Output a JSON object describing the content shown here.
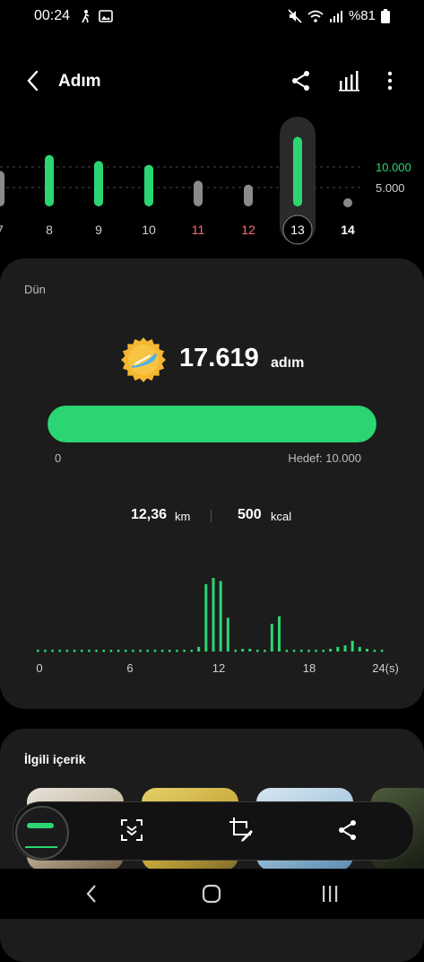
{
  "status": {
    "time": "00:24",
    "battery": "%81",
    "icons": [
      "person-walk-icon",
      "image-icon",
      "mute-icon",
      "wifi-icon",
      "signal-icon",
      "battery-icon"
    ]
  },
  "header": {
    "title": "Adım",
    "actions": [
      "share-icon",
      "stats-icon",
      "more-vert-icon"
    ]
  },
  "week_chart": {
    "days": [
      "7",
      "8",
      "9",
      "10",
      "11",
      "12",
      "13",
      "14"
    ],
    "goal_label": "10.000",
    "half_label": "5.000",
    "selected": "13",
    "day_colors": {
      "7": "#cfcfcf",
      "8": "#cfcfcf",
      "9": "#cfcfcf",
      "10": "#cfcfcf",
      "11": "#ff6b6b",
      "12": "#ff6b6b",
      "13": "#ffffff",
      "14": "#ffffff"
    },
    "steps": [
      9000,
      13000,
      11500,
      10500,
      6500,
      5500,
      17619,
      1200
    ],
    "met_goal": [
      false,
      true,
      true,
      true,
      false,
      false,
      true,
      false
    ]
  },
  "summary": {
    "day_label": "Dün",
    "steps": "17.619",
    "steps_unit": "adım",
    "progress_min": "0",
    "goal_text": "Hedef: 10.000",
    "progress_fraction": 1.0,
    "distance_value": "12,36",
    "distance_unit": "km",
    "calories_value": "500",
    "calories_unit": "kcal",
    "accent_color": "#2bd672"
  },
  "chart_data": {
    "type": "bar",
    "x_ticks": [
      "0",
      "6",
      "12",
      "18",
      "24(s)"
    ],
    "x": [
      0.0,
      0.5,
      1.0,
      1.5,
      2.0,
      2.5,
      3.0,
      3.5,
      4.0,
      4.5,
      5.0,
      5.5,
      6.0,
      6.5,
      7.0,
      7.5,
      8.0,
      8.5,
      9.0,
      9.5,
      10.0,
      10.5,
      11.0,
      11.5,
      12.0,
      12.5,
      13.0,
      13.5,
      14.0,
      14.5,
      15.0,
      15.5,
      16.0,
      16.5,
      17.0,
      17.5,
      18.0,
      18.5,
      19.0,
      19.5,
      20.0,
      20.5,
      21.0,
      21.5,
      22.0,
      22.5,
      23.0,
      23.5
    ],
    "values": [
      0,
      0,
      0,
      0,
      0,
      0,
      0,
      0,
      0,
      0,
      0,
      0,
      0,
      0,
      0,
      0,
      0,
      0,
      0,
      0,
      0,
      0,
      150,
      2200,
      2400,
      2300,
      1100,
      0,
      50,
      50,
      0,
      0,
      900,
      1150,
      0,
      0,
      0,
      0,
      0,
      0,
      50,
      150,
      200,
      350,
      150,
      50,
      0,
      0
    ],
    "xlim": [
      0,
      24
    ],
    "grid": false
  },
  "related": {
    "title": "İlgili içerik"
  },
  "toolbar": {
    "buttons": [
      "scroll-capture-icon",
      "crop-edit-icon",
      "share-icon"
    ]
  },
  "navbar": {
    "buttons": [
      "back-nav-icon",
      "home-nav-icon",
      "recents-nav-icon"
    ]
  }
}
